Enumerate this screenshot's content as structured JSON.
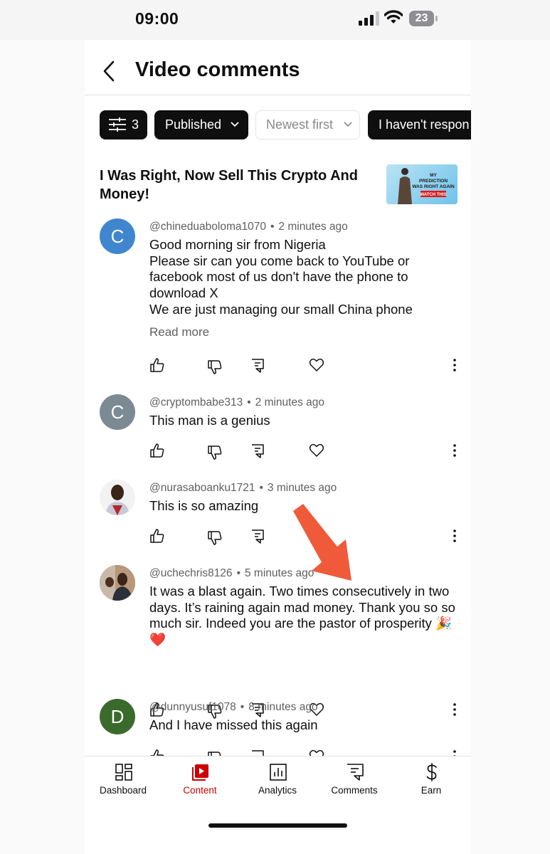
{
  "status_bar": {
    "time": "09:00",
    "battery": "23"
  },
  "header": {
    "title": "Video comments"
  },
  "filters": {
    "filter_count": "3",
    "published": "Published",
    "sort": "Newest first",
    "response": "I haven't respon"
  },
  "video": {
    "title": "I Was Right, Now Sell This Crypto And Money!",
    "thumb_text": "MY PREDICTION WAS RIGHT AGAIN",
    "thumb_badge": "WATCH THIS"
  },
  "comments": [
    {
      "author": "@chineduaboloma1070",
      "time": "2 minutes ago",
      "avatar_letter": "C",
      "avatar_color": "#3f86cf",
      "text": "Good morning sir from Nigeria\nPlease sir can you come back to YouTube or facebook most of us don't have the phone to download X\nWe are just managing our small China phone",
      "read_more": "Read more"
    },
    {
      "author": "@cryptombabe313",
      "time": "2 minutes ago",
      "avatar_letter": "C",
      "avatar_color": "#7b8a93",
      "text": "This man is a genius"
    },
    {
      "author": "@nurasaboanku1721",
      "time": "3 minutes ago",
      "avatar_letter": "",
      "text": "This is so amazing"
    },
    {
      "author": "@uchechris8126",
      "time": "5 minutes ago",
      "avatar_letter": "",
      "text": "It was a blast again. Two times consecutively in two days. It’s raining again mad money. Thank you so so much sir. Indeed you are the pastor of prosperity 🎉\n❤️"
    },
    {
      "author": "@dunnyusuf1078",
      "time": "8 minutes ago",
      "avatar_letter": "D",
      "avatar_color": "#3a6b2c",
      "text": "And I have missed this again"
    }
  ],
  "nav": {
    "dashboard": "Dashboard",
    "content": "Content",
    "analytics": "Analytics",
    "comments": "Comments",
    "earn": "Earn"
  },
  "colors": {
    "accent": "#cc0000",
    "annotation_arrow": "#ef5a3a"
  }
}
